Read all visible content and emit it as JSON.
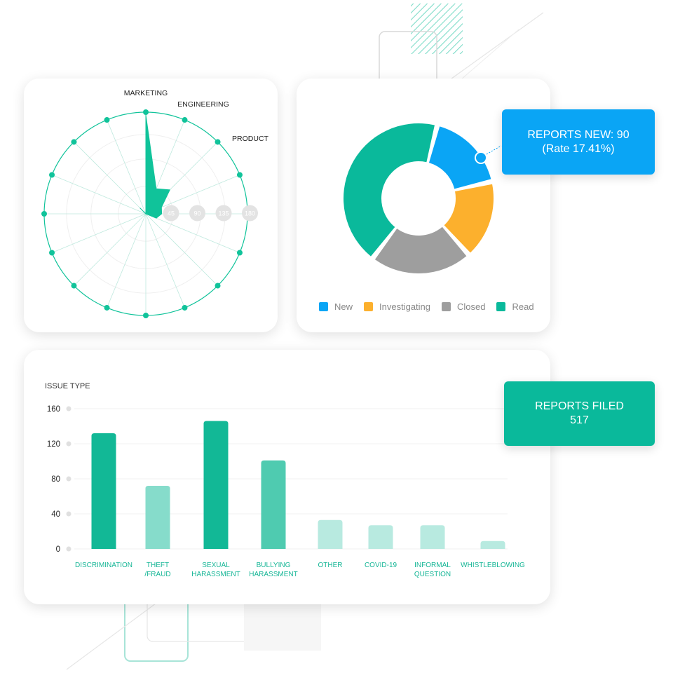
{
  "radar": {
    "labels": [
      "MARKETING",
      "ENGINEERING",
      "PRODUCT"
    ],
    "scale_ticks": [
      "45",
      "90",
      "135",
      "180"
    ],
    "max": 180,
    "axis_count": 16,
    "values": [
      175,
      48,
      60,
      30,
      28,
      20,
      0,
      0,
      0,
      0,
      0,
      0,
      0,
      0,
      15,
      0
    ],
    "color": "#10c39a"
  },
  "donut": {
    "segments": [
      {
        "label": "New",
        "value": 17.41,
        "color": "#0aa5f5"
      },
      {
        "label": "Investigating",
        "value": 17,
        "color": "#fcb02d"
      },
      {
        "label": "Closed",
        "value": 22,
        "color": "#9e9e9e"
      },
      {
        "label": "Read",
        "value": 43.59,
        "color": "#0ab99b"
      }
    ],
    "callout": {
      "line1": "REPORTS NEW: 90",
      "line2": "(Rate 17.41%)"
    }
  },
  "chart_data": {
    "type": "bar",
    "title": "ISSUE TYPE",
    "categories": [
      "DISCRIMINATION",
      "THEFT\n/FRAUD",
      "SEXUAL\nHARASSMENT",
      "BULLYING\nHARASSMENT",
      "OTHER",
      "COVID-19",
      "INFORMAL\nQUESTION",
      "WHISTLEBLOWING"
    ],
    "values": [
      132,
      72,
      146,
      101,
      33,
      27,
      27,
      9
    ],
    "colors": [
      "#12b896",
      "#86dccb",
      "#12b896",
      "#4fcbb0",
      "#b8eae0",
      "#b8eae0",
      "#b8eae0",
      "#b8eae0"
    ],
    "yticks": [
      0,
      40,
      80,
      120,
      160
    ],
    "ylim": [
      0,
      160
    ]
  },
  "summary": {
    "line1": "REPORTS FILED",
    "line2": "517"
  }
}
